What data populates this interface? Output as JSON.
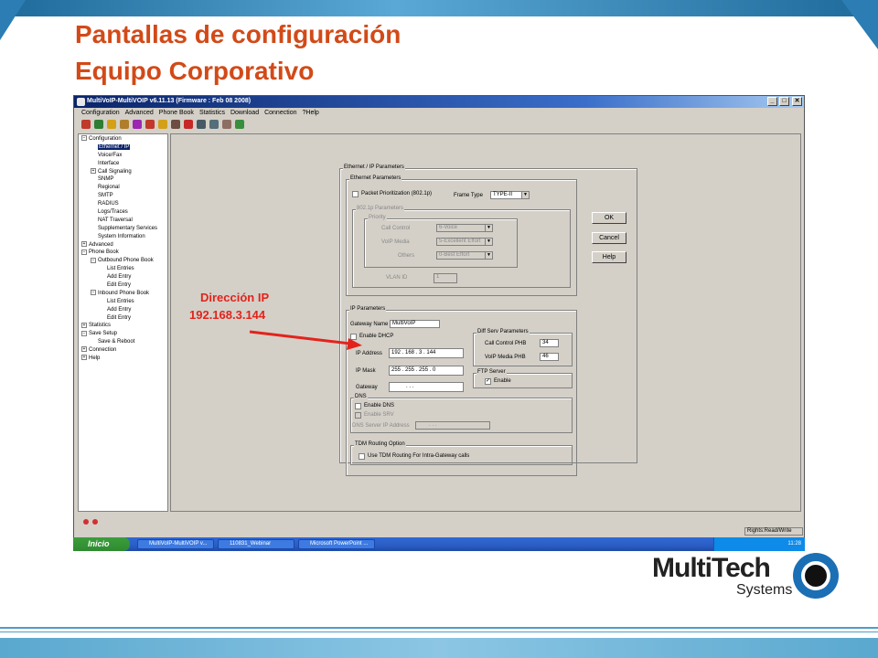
{
  "slide": {
    "title_line1": "Pantallas de configuración",
    "title_line2": "Equipo Corporativo"
  },
  "window": {
    "title": "MultiVoIP-MultiVOIP v6.11.13 (Firmware : Feb 08 2008)",
    "menu": [
      "Configuration",
      "Advanced",
      "Phone Book",
      "Statistics",
      "Download",
      "Connection",
      "?Help"
    ],
    "min_label": "_",
    "max_label": "□",
    "close_label": "✕"
  },
  "tree": [
    {
      "label": "Configuration",
      "level": 0,
      "expander": "−"
    },
    {
      "label": "Ethernet / IP",
      "level": 1,
      "selected": true
    },
    {
      "label": "Voice/Fax",
      "level": 1
    },
    {
      "label": "Interface",
      "level": 1
    },
    {
      "label": "Call Signaling",
      "level": 1,
      "expander": "+"
    },
    {
      "label": "SNMP",
      "level": 1
    },
    {
      "label": "Regional",
      "level": 1
    },
    {
      "label": "SMTP",
      "level": 1
    },
    {
      "label": "RADIUS",
      "level": 1
    },
    {
      "label": "Logs/Traces",
      "level": 1
    },
    {
      "label": "NAT Traversal",
      "level": 1
    },
    {
      "label": "Supplementary Services",
      "level": 1
    },
    {
      "label": "System Information",
      "level": 1
    },
    {
      "label": "Advanced",
      "level": 0,
      "expander": "+"
    },
    {
      "label": "Phone Book",
      "level": 0,
      "expander": "−"
    },
    {
      "label": "Outbound Phone Book",
      "level": 1,
      "expander": "−"
    },
    {
      "label": "List Entries",
      "level": 2
    },
    {
      "label": "Add Entry",
      "level": 2
    },
    {
      "label": "Edit Entry",
      "level": 2
    },
    {
      "label": "Inbound Phone Book",
      "level": 1,
      "expander": "−"
    },
    {
      "label": "List Entries",
      "level": 2
    },
    {
      "label": "Add Entry",
      "level": 2
    },
    {
      "label": "Edit Entry",
      "level": 2
    },
    {
      "label": "Statistics",
      "level": 0,
      "expander": "+"
    },
    {
      "label": "Save Setup",
      "level": 0,
      "expander": "−"
    },
    {
      "label": "Save & Reboot",
      "level": 1
    },
    {
      "label": "Connection",
      "level": 0,
      "expander": "+"
    },
    {
      "label": "Help",
      "level": 0,
      "expander": "+"
    }
  ],
  "form": {
    "outer_group": "Ethernet / IP Parameters",
    "ethernet_group": "Ethernet Parameters",
    "packet_prio_label": "Packet Prioritization (802.1p)",
    "frame_type_label": "Frame Type",
    "frame_type_value": "TYPE-II",
    "p8021_group": "802.1p Parameters",
    "priority_group": "Priority",
    "call_control_label": "Call Control",
    "call_control_value": "6-Voice",
    "voip_media_label": "VoIP Media",
    "voip_media_value": "5-Excellent Effort",
    "others_label": "Others",
    "others_value": "0-Best Effort",
    "vlan_label": "VLAN ID",
    "vlan_value": "1",
    "ip_group": "IP Parameters",
    "gateway_name_label": "Gateway Name",
    "gateway_name_value": "MultiVoIP",
    "enable_dhcp_label": "Enable DHCP",
    "ip_address_label": "IP Address",
    "ip_address_value": "192 .  168 .    3  .  144",
    "ip_mask_label": "IP Mask",
    "ip_mask_value": "255 .  255 .  255 .    0",
    "gateway_label": "Gateway",
    "gateway_value": ".         .         .",
    "diffserv_group": "Diff Serv Parameters",
    "call_control_phb_label": "Call Control PHB",
    "call_control_phb_value": "34",
    "voip_media_phb_label": "VoIP Media PHB",
    "voip_media_phb_value": "46",
    "ftp_group": "FTP Server",
    "ftp_enable_label": "Enable",
    "ftp_enable_mark": "✓",
    "dns_group": "DNS",
    "enable_dns_label": "Enable DNS",
    "enable_srv_label": "Enable SRV",
    "dns_server_label": "DNS Server IP Address",
    "dns_server_value": ".         .         .",
    "tdm_group": "TDM Routing Option",
    "tdm_label": "Use TDM Routing For Intra-Gateway calls",
    "ok_label": "OK",
    "cancel_label": "Cancel",
    "help_label": "Help"
  },
  "status": {
    "rights": "Rights:Read/Write"
  },
  "annotation": {
    "line1": "Dirección IP",
    "line2": "192.168.3.144",
    "color": "#e3231b"
  },
  "taskbar": {
    "start": "Inicio",
    "tasks": [
      "MultiVoIP-MultiVOIP v...",
      "110831_Webinar",
      "Microsoft PowerPoint ..."
    ],
    "clock": "11:28"
  },
  "logo": {
    "word1": "Multi",
    "word2": "Tech",
    "sub": "Systems"
  },
  "colors": {
    "title": "#d24a18",
    "accent_blue": "#2b7db3",
    "window_title": "#0a246a"
  }
}
